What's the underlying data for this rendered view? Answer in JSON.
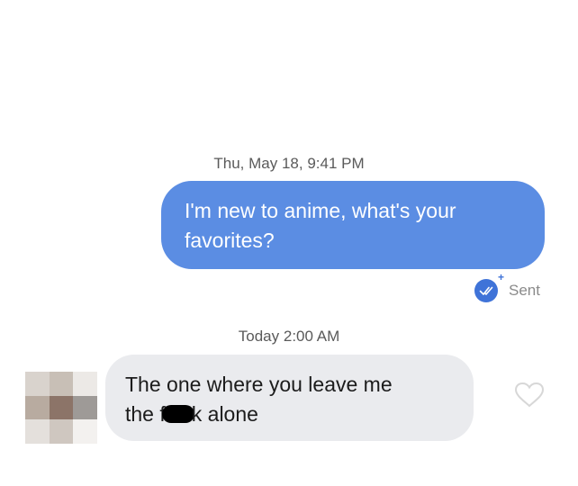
{
  "conversation": {
    "timestamp_1": {
      "day": "Thu, May 18,",
      "time": "9:41 PM"
    },
    "outgoing_message": {
      "line1": "I'm new to anime, what's your",
      "line2": "favorites?",
      "bubble_color": "#5b8de3"
    },
    "status": {
      "label": "Sent",
      "icon": "check-circle-icon",
      "icon_color": "#3f73d8"
    },
    "timestamp_2": {
      "day": "Today",
      "time": "2:00 AM"
    },
    "incoming_message": {
      "line1": "The one where you leave me",
      "line2_before": "the f",
      "line2_after": "k alone",
      "bubble_color": "#eaebee"
    },
    "like_icon": "heart-outline-icon"
  }
}
